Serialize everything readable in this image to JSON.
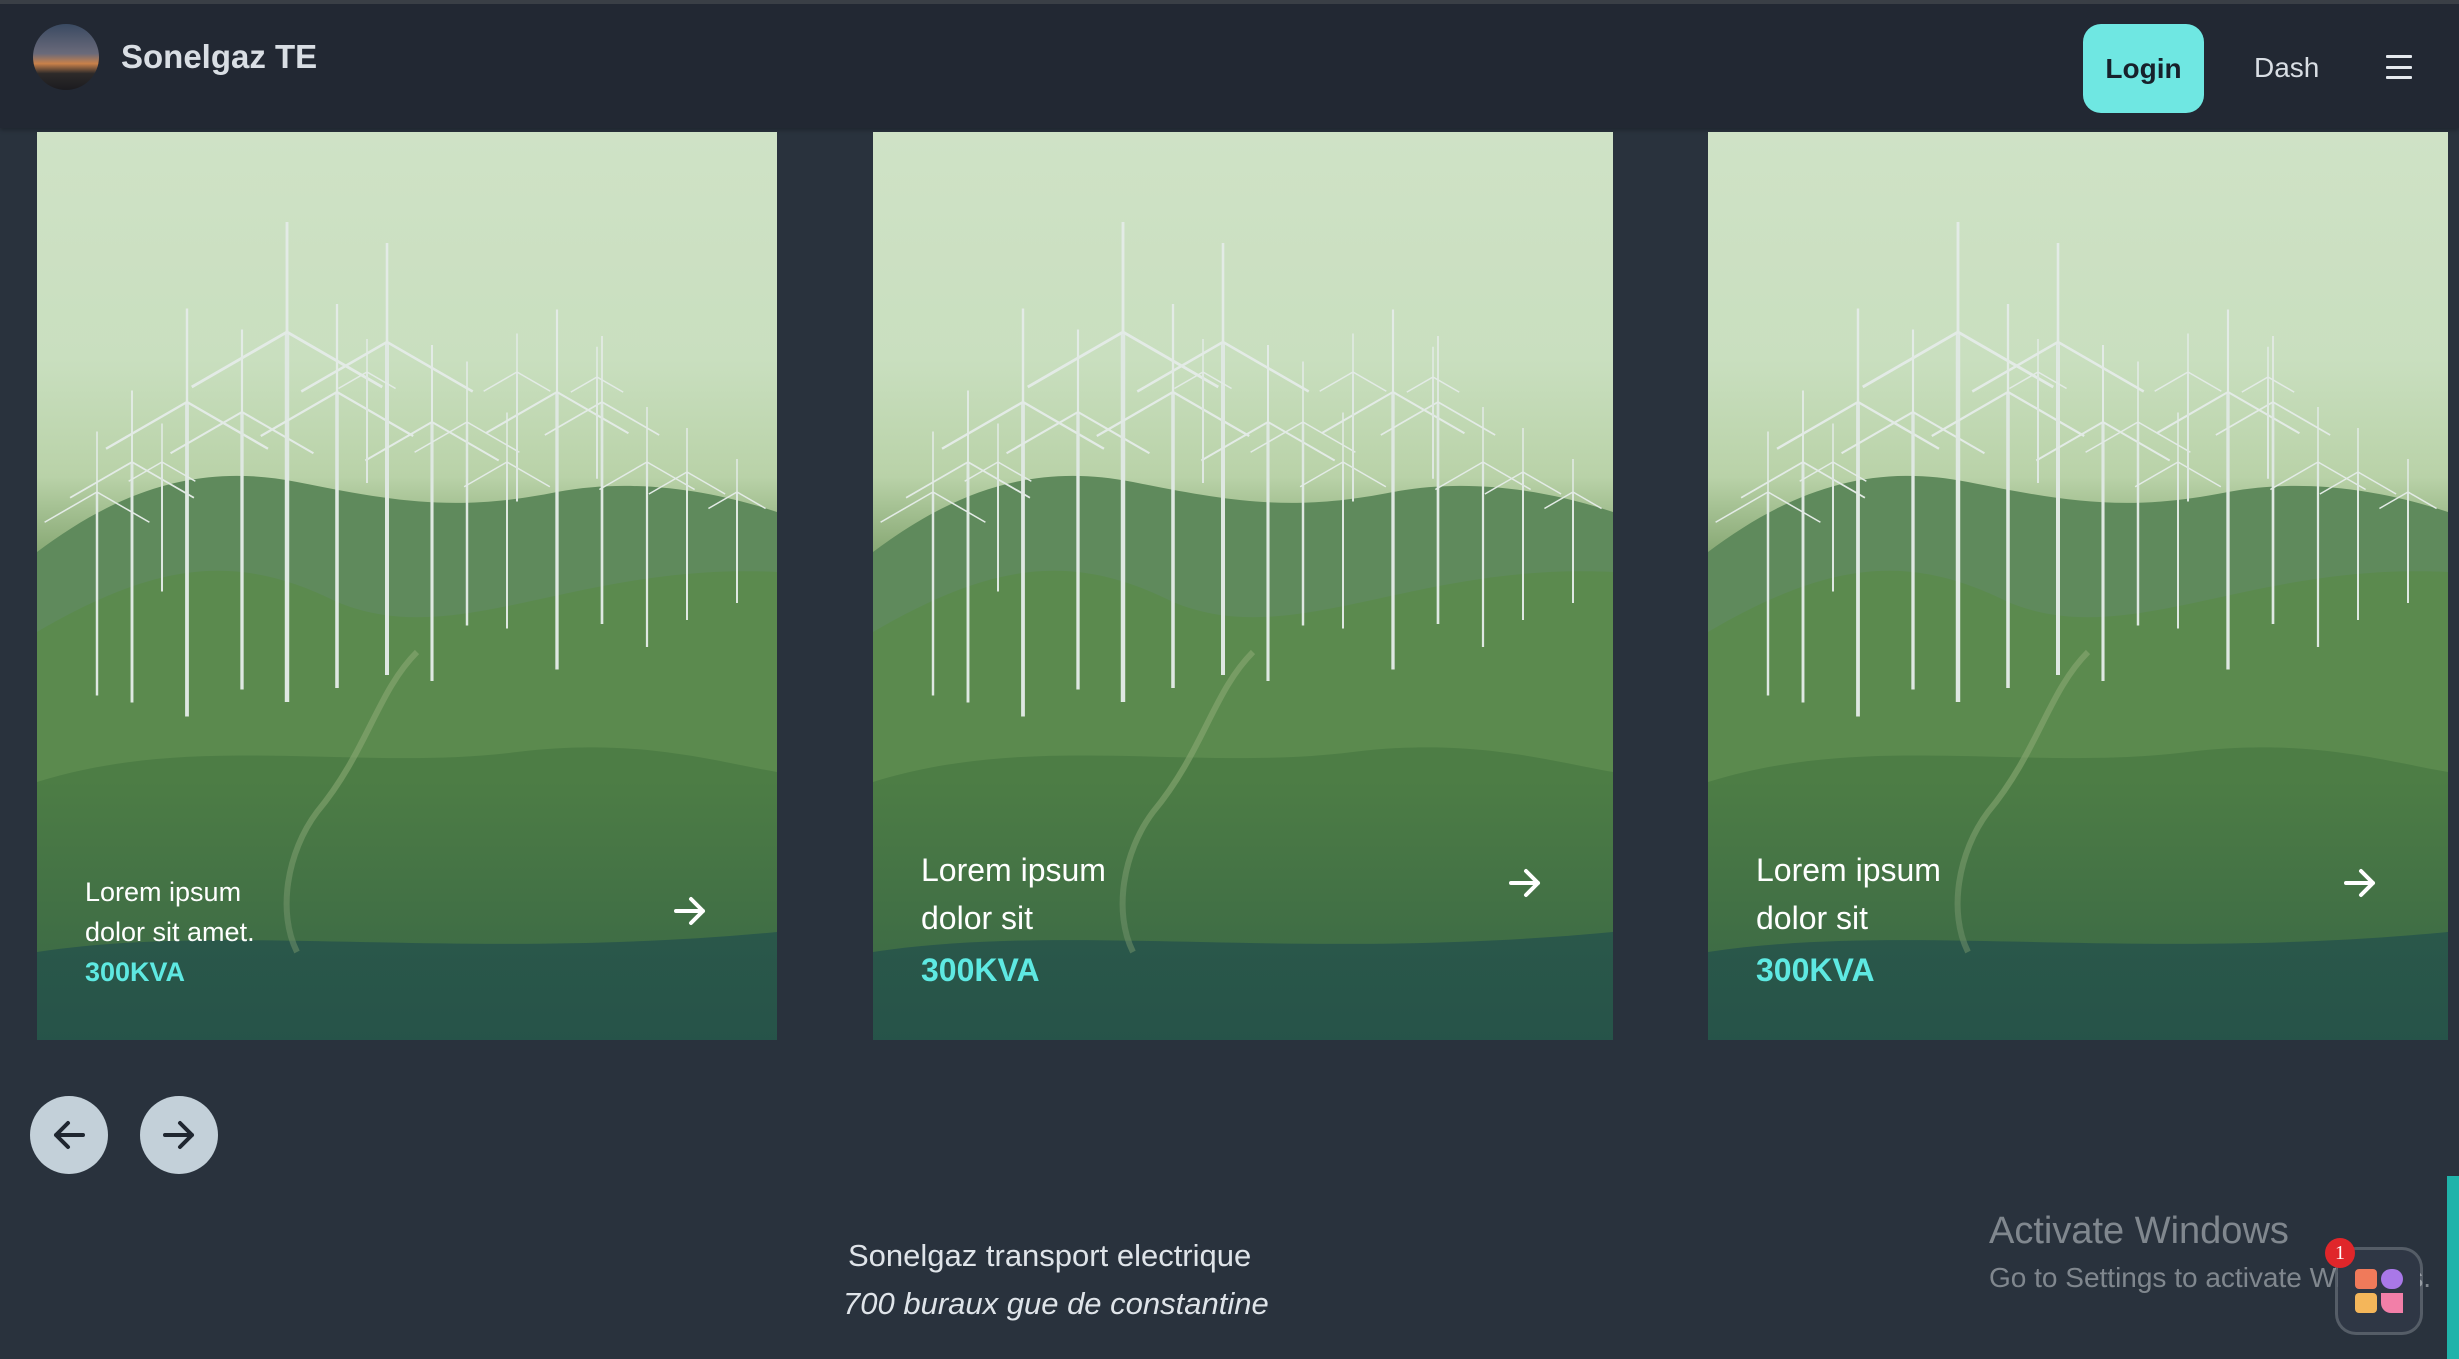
{
  "header": {
    "brand": "Sonelgaz TE",
    "login_label": "Login",
    "dash_label": "Dash",
    "logo_icon": "sunset-logo-icon",
    "menu_icon": "hamburger-menu-icon"
  },
  "cards": [
    {
      "line1": "Lorem ipsum",
      "line2": "dolor sit amet.",
      "power": "300KVA"
    },
    {
      "line1": "Lorem ipsum",
      "line2": "dolor sit",
      "power": "300KVA"
    },
    {
      "line1": "Lorem ipsum",
      "line2": "dolor sit",
      "power": "300KVA"
    }
  ],
  "carousel": {
    "prev_icon": "arrow-left-icon",
    "next_icon": "arrow-right-icon"
  },
  "footer": {
    "company": "Sonelgaz transport electrique",
    "address": "700 buraux gue de constantine"
  },
  "watermark": {
    "title": "Activate Windows",
    "subtitle": "Go to Settings to activate Windows."
  },
  "widget": {
    "badge": "1"
  },
  "colors": {
    "accent": "#6fe7e2",
    "power_text": "#5ee9e2",
    "background": "#29323d",
    "navbar": "#222833"
  }
}
